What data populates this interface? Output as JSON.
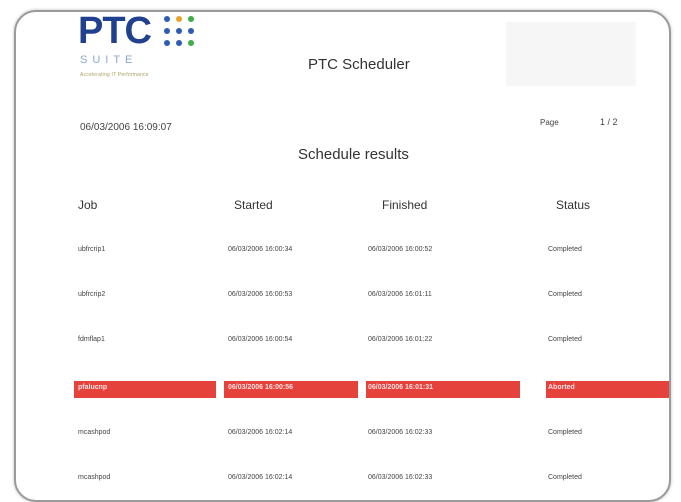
{
  "brand": {
    "logo_main": "PTC",
    "logo_suite": "SUITE",
    "logo_tagline": "Accelerating IT Performance",
    "dot_colors": [
      "#2f5bb5",
      "#e8a22a",
      "#3fae49",
      "#2f5bb5",
      "#2f5bb5",
      "#2f5bb5",
      "#2f5bb5",
      "#2f5bb5",
      "#3fae49"
    ]
  },
  "header": {
    "app_title": "PTC Scheduler",
    "timestamp": "06/03/2006 16:09:07",
    "page_label": "Page",
    "page_number": "1 / 2"
  },
  "report": {
    "title": "Schedule results",
    "columns": [
      "Job",
      "Started",
      "Finished",
      "Status"
    ],
    "rows": [
      {
        "job": "ubfrcrip1",
        "started": "06/03/2006 16:00:34",
        "finished": "06/03/2006 16:00:52",
        "status": "Completed",
        "failed": false
      },
      {
        "job": "ubfrcrip2",
        "started": "06/03/2006 16:00:53",
        "finished": "06/03/2006 16:01:11",
        "status": "Completed",
        "failed": false
      },
      {
        "job": "fdmflap1",
        "started": "06/03/2006 16:00:54",
        "finished": "06/03/2006 16:01:22",
        "status": "Completed",
        "failed": false
      },
      {
        "job": "pfalucnp",
        "started": "06/03/2006 16:00:56",
        "finished": "06/03/2006 16:01:31",
        "status": "Aborted",
        "failed": true
      },
      {
        "job": "mcashpod",
        "started": "06/03/2006 16:02:14",
        "finished": "06/03/2006 16:02:33",
        "status": "Completed",
        "failed": false
      },
      {
        "job": "mcashpod",
        "started": "06/03/2006 16:02:14",
        "finished": "06/03/2006 16:02:33",
        "status": "Completed",
        "failed": false
      }
    ]
  },
  "colors": {
    "accent_blue": "#21418f",
    "failed_row": "#e6423c"
  }
}
